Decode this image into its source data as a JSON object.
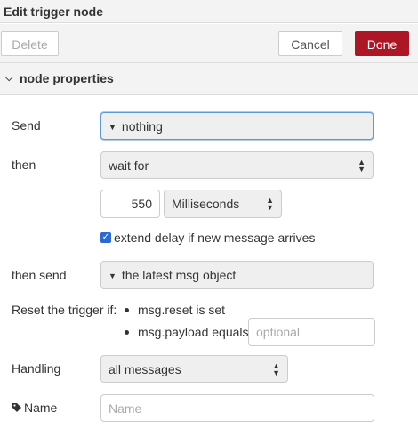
{
  "title": "Edit trigger node",
  "toolbar": {
    "delete": "Delete",
    "cancel": "Cancel",
    "done": "Done"
  },
  "section": {
    "label": "node properties"
  },
  "form": {
    "send_label": "Send",
    "send_value": "nothing",
    "then_label": "then",
    "then_value": "wait for",
    "duration_value": "550",
    "duration_unit": "Milliseconds",
    "extend_label": "extend delay if new message arrives",
    "extend_checked": true,
    "then_send_label": "then send",
    "then_send_value": "the latest msg object",
    "reset_label": "Reset the trigger if:",
    "reset_option1": "msg.reset is set",
    "reset_option2": "msg.payload equals",
    "reset_placeholder": "optional",
    "handling_label": "Handling",
    "handling_value": "all messages",
    "name_label": "Name",
    "name_placeholder": "Name"
  },
  "colors": {
    "done_button": "#ad1625",
    "checkbox": "#2a6ad4"
  }
}
